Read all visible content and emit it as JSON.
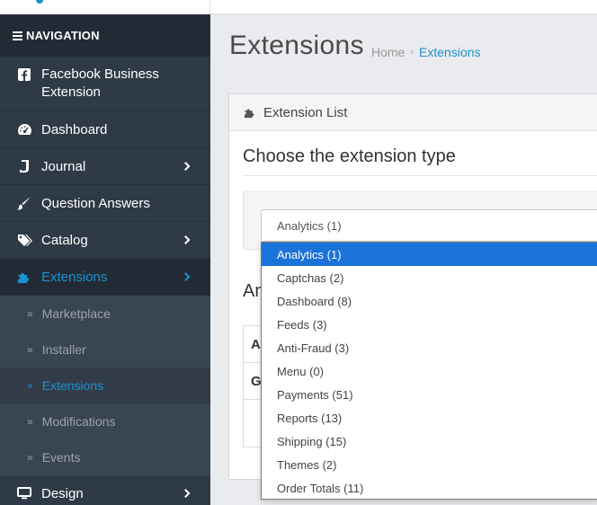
{
  "nav": {
    "header": "NAVIGATION",
    "items": [
      {
        "label": "Facebook Business Extension",
        "icon": "facebook-square-icon"
      },
      {
        "label": "Dashboard",
        "icon": "dashboard-icon"
      },
      {
        "label": "Journal",
        "icon": "journal-icon"
      },
      {
        "label": "Question Answers",
        "icon": "brush-icon"
      },
      {
        "label": "Catalog",
        "icon": "tags-icon"
      },
      {
        "label": "Extensions",
        "icon": "puzzle-icon"
      },
      {
        "label": "Design",
        "icon": "monitor-icon"
      }
    ],
    "sub_items": [
      "Marketplace",
      "Installer",
      "Extensions",
      "Modifications",
      "Events"
    ]
  },
  "page": {
    "title": "Extensions",
    "breadcrumb_home": "Home",
    "breadcrumb_sep": "›",
    "breadcrumb_current": "Extensions"
  },
  "panel": {
    "heading": "Extension List",
    "choose_title": "Choose the extension type",
    "analytics_heading_fragment": "An",
    "table_rows": [
      "A",
      "G",
      ""
    ]
  },
  "select": {
    "value": "Analytics (1)",
    "options": [
      "Analytics (1)",
      "Captchas (2)",
      "Dashboard (8)",
      "Feeds (3)",
      "Anti-Fraud (3)",
      "Menu (0)",
      "Payments (51)",
      "Reports (13)",
      "Shipping (15)",
      "Themes (2)",
      "Order Totals (11)"
    ]
  },
  "colors": {
    "sidebar_bg": "#2f3a47",
    "accent": "#1e91cf",
    "selected_option": "#1a73d9"
  }
}
